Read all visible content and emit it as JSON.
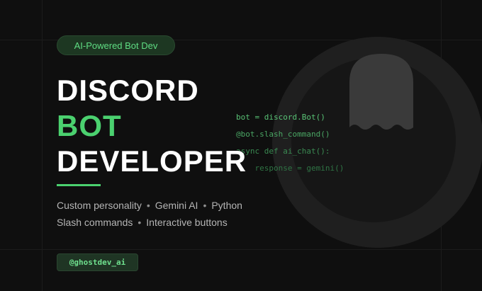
{
  "badge": {
    "label": "AI-Powered Bot Dev"
  },
  "title": {
    "line1": "DISCORD",
    "line2": "BOT",
    "line3": "DEVELOPER"
  },
  "features": {
    "row1": [
      "Custom personality",
      "Gemini AI",
      "Python"
    ],
    "row2": [
      "Slash commands",
      "Interactive buttons"
    ],
    "separator": "•"
  },
  "handle": {
    "label": "@ghostdev_ai"
  },
  "code": [
    "bot = discord.Bot()",
    "@bot.slash_command()",
    "async def ai_chat():",
    "    response = gemini()"
  ],
  "colors": {
    "accent": "#4bd16f",
    "background": "#0f0f0f",
    "badge_bg": "#1d3722"
  },
  "icons": {
    "mascot": "ghost-icon"
  }
}
